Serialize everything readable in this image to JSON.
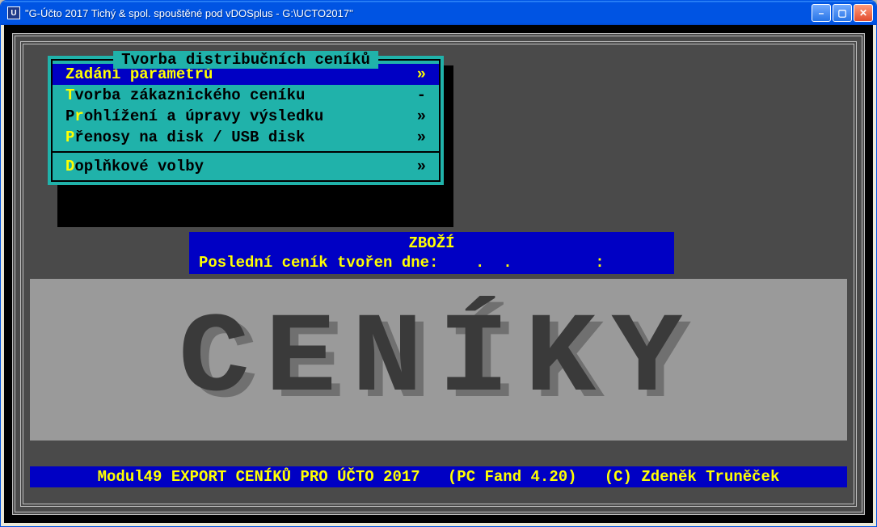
{
  "window": {
    "title": "\"G-Účto 2017 Tichý & spol. spouštěné pod vDOSplus - G:\\UCTO2017\""
  },
  "menu": {
    "title": "Tvorba distribučních ceníků",
    "items": [
      {
        "hot": "",
        "label": "Zadání parametrů",
        "mark": "»",
        "selected": true
      },
      {
        "hot": "T",
        "label": "vorba zákaznického ceníku",
        "mark": "-",
        "selected": false
      },
      {
        "hot": "",
        "prefix": "P",
        "hot2": "r",
        "label": "ohlížení a úpravy výsledku",
        "mark": "»",
        "selected": false
      },
      {
        "hot": "P",
        "label": "řenosy na disk / USB disk",
        "mark": "»",
        "selected": false
      }
    ],
    "extra": {
      "hot": "D",
      "label": "oplňkové volby",
      "mark": "»"
    }
  },
  "status": {
    "line1": "ZBOŽÍ",
    "line2": "Poslední ceník tvořen dne:    .  .         :"
  },
  "big_title": "CENÍKY",
  "footer": "Modul49 EXPORT CENÍKŮ PRO ÚČTO 2017   (PC Fand 4.20)   (C) Zdeněk Truněček"
}
